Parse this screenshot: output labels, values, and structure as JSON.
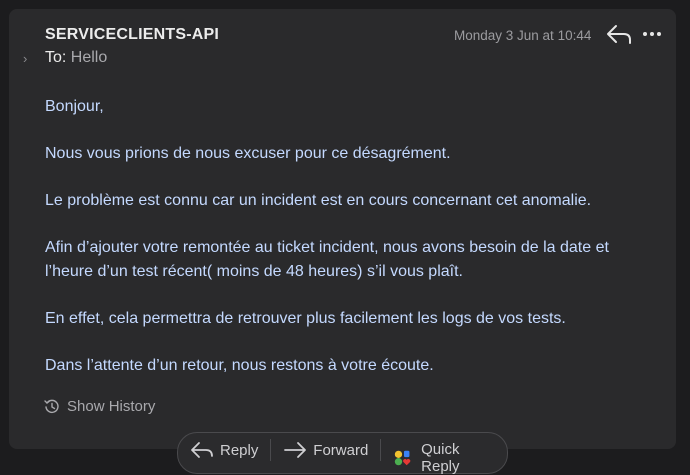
{
  "message": {
    "sender": "SERVICECLIENTS-API",
    "date": "Monday 3 Jun at 10:44",
    "to_label": "To:",
    "to_value": "Hello",
    "body": [
      "Bonjour,",
      "Nous vous prions de nous excuser pour ce désagrément.",
      "Le problème est connu car un incident est en cours concernant cet anomalie.",
      "Afin d’ajouter votre remontée au ticket incident, nous avons besoin de la date et l’heure d’un test récent( moins de 48 heures) s’il vous plaît.",
      "En effet, cela permettra de retrouver plus facilement les logs de vos tests.",
      "Dans l’attente d’un retour, nous restons à votre écoute."
    ],
    "show_history": "Show History"
  },
  "actions": {
    "reply": "Reply",
    "forward": "Forward",
    "quick_reply": "Quick Reply"
  },
  "icons": {
    "header_reply": "reply-arrow-icon",
    "more": "more-options-icon",
    "expand": "chevron-right-icon",
    "history": "history-clock-icon",
    "quick_reply": "emoji-reactions-icon"
  },
  "colors": {
    "background": "#1c1c1e",
    "card": "#2a2a2c",
    "body_text": "#c4d9ff",
    "muted": "#9b9b9f"
  }
}
